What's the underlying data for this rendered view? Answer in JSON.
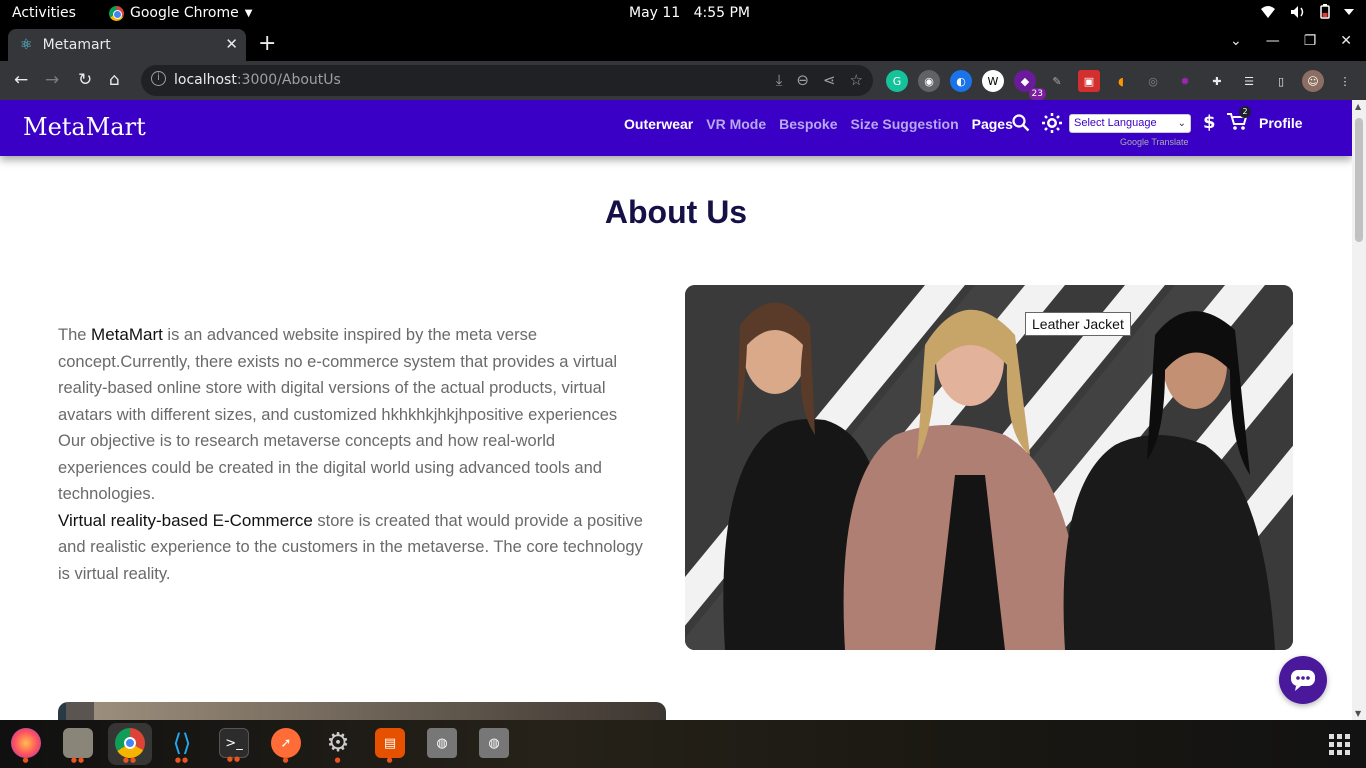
{
  "system_bar": {
    "activities": "Activities",
    "app_name": "Google Chrome",
    "date": "May 11",
    "time": "4:55 PM"
  },
  "browser": {
    "tab_title": "Metamart",
    "url_host": "localhost",
    "url_path": ":3000/AboutUs",
    "extension_badge": "23"
  },
  "site": {
    "brand": "MetaMart",
    "nav": [
      {
        "label": "Outerwear"
      },
      {
        "label": "VR Mode"
      },
      {
        "label": "Bespoke"
      },
      {
        "label": "Size Suggestion"
      },
      {
        "label": "Pages"
      }
    ],
    "language_select": "Select Language",
    "powered_by": "Google Translate",
    "currency_symbol": "$",
    "cart_count": "2",
    "profile": "Profile",
    "accent_color": "#3a00c6"
  },
  "about": {
    "title": "About Us",
    "p1_pre": "The ",
    "p1_strong": "MetaMart",
    "p1_post": " is an advanced website inspired by the meta verse concept.Currently, there exists no e-commerce system that provides a virtual reality-based online store with digital versions of the actual products, virtual avatars with different sizes, and customized hkhkhkjhkjhpositive experiences Our objective is to research metaverse concepts and how real-world experiences could be created in the digital world using advanced tools and technologies.",
    "p2_strong": "Virtual reality-based E-Commerce",
    "p2_post": " store is created that would provide a positive and realistic experience to the customers in the metaverse. The core technology is virtual reality.",
    "image_tooltip": "Leather Jacket"
  }
}
